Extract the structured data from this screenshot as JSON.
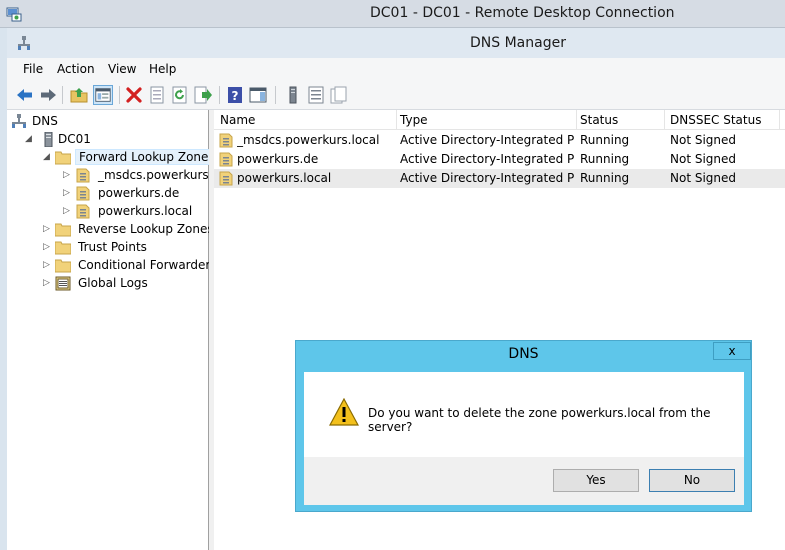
{
  "rdc": {
    "title": "DC01 - DC01 - Remote Desktop Connection"
  },
  "window": {
    "title": "DNS Manager"
  },
  "menu": [
    "File",
    "Action",
    "View",
    "Help"
  ],
  "toolbar": {
    "icons": [
      "back-icon",
      "forward-icon",
      "up-folder-icon",
      "show-hide-tree-icon",
      "delete-icon",
      "properties-icon",
      "refresh-icon",
      "export-list-icon",
      "help-icon",
      "show-hide-action-pane-icon",
      "server-icon",
      "zone-list-icon",
      "records-icon"
    ]
  },
  "tree": {
    "root": "DNS",
    "server": "DC01",
    "forward": "Forward Lookup Zones",
    "zones": [
      "_msdcs.powerkurs.local",
      "powerkurs.de",
      "powerkurs.local"
    ],
    "reverse": "Reverse Lookup Zones",
    "trust": "Trust Points",
    "cond": "Conditional Forwarders",
    "logs": "Global Logs"
  },
  "list": {
    "headers": {
      "name": "Name",
      "type": "Type",
      "status": "Status",
      "dnssec": "DNSSEC Status"
    },
    "rows": [
      {
        "name": "_msdcs.powerkurs.local",
        "type": "Active Directory-Integrated Pr...",
        "status": "Running",
        "dnssec": "Not Signed"
      },
      {
        "name": "powerkurs.de",
        "type": "Active Directory-Integrated Pr...",
        "status": "Running",
        "dnssec": "Not Signed"
      },
      {
        "name": "powerkurs.local",
        "type": "Active Directory-Integrated Pr...",
        "status": "Running",
        "dnssec": "Not Signed"
      }
    ]
  },
  "dialog": {
    "title": "DNS",
    "close": "x",
    "message": "Do you want to delete the zone powerkurs.local from the server?",
    "yes": "Yes",
    "no": "No"
  },
  "colors": {
    "dialog_frame": "#5ec6ea",
    "delete_red": "#d32020",
    "nav_blue": "#2a73c4"
  }
}
